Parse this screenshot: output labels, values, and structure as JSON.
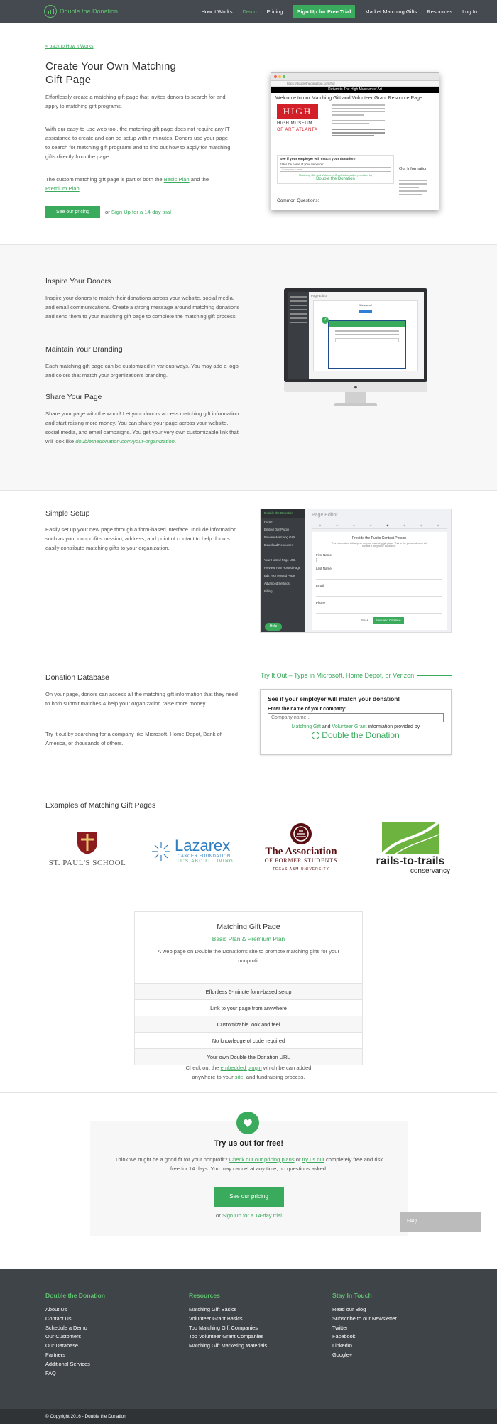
{
  "nav": {
    "logo_text": "Double the Donation",
    "items": [
      "How it Works",
      "Demo",
      "Pricing"
    ],
    "cta": "Sign Up for Free Trial",
    "items2": [
      "Market Matching Gifts",
      "Resources",
      "Log In"
    ]
  },
  "hero": {
    "back_link": "< back to How it Works",
    "title_line1": "Create Your Own Matching",
    "title_line2": "Gift Page",
    "p1": "Effortlessly create a matching gift page that invites donors to search for and apply to matching gift programs.",
    "p2": "With our easy-to-use web tool, the matching gift page does not require any IT assistance to create and can be setup within minutes. Donors use your page to search for matching gift programs and to find out how to apply for matching gifts directly from the page.",
    "p3_pre": "The custom matching gift page is part of both the ",
    "p3_link1": "Basic Plan",
    "p3_mid": " and the ",
    "p3_link2": "Premium Plan",
    "btn": "See our pricing",
    "or": "or",
    "trial": "Sign Up for a 14-day trial"
  },
  "hero_shot": {
    "url": "https://doublethedonation.com/hgl",
    "banner": "Return to The High Museum of Art",
    "welcome": "Welcome to our Matching Gift and Volunteer Grant Resource Page",
    "high": "HIGH",
    "museum1": "HIGH MUSEUM",
    "museum2": "OF ART ATLANTA",
    "search_title": "See if your employer will match your donation!",
    "search_label": "Enter the name of your company:",
    "search_ph": "Company name...",
    "search_info": "Matching Gift and Volunteer Grant information provided by",
    "common": "Common Questions:",
    "org": "Our Information"
  },
  "inspire": {
    "h": "Inspire Your Donors",
    "p": "Inspire your donors to match their donations across your website, social media, and email communications. Create a strong message around matching donations and send them to your matching gift page to complete the matching gift process."
  },
  "brand": {
    "h": "Maintain Your Branding",
    "p": "Each matching gift page can be customized in various ways. You may add a logo and colors that match your organization's branding."
  },
  "share": {
    "h": "Share Your Page",
    "p": "Share your page with the world! Let your donors access matching gift information and start raising more money. You can share your page across your website, social media, and email campaigns. You get your very own customizable link that will look like ",
    "link": "doublethedonation.com/your-organization",
    "end": "."
  },
  "mac_shot": {
    "title": "Page Editor",
    "welcome": "Welcome!"
  },
  "setup": {
    "h": "Simple Setup",
    "p": "Easily set up your new page through a form-based interface. Include information such as your nonprofit's mission, address, and point of contact to help donors easily contribute matching gifts to your organization."
  },
  "editor": {
    "brand": "Double the Donation",
    "title": "Page Editor",
    "menu": [
      "Home",
      "Embed Our Plugin",
      "Preview Matching Gifts",
      "Download Resources",
      "Your Hosted Page URL",
      "Preview Your Hosted Page",
      "Edit Your Hosted Page",
      "Advanced Settings",
      "Billing"
    ],
    "help": "Help",
    "form_title": "Provide the Public Contact Person",
    "form_sub": "This information will appear on your matching gift page. This is the person donors will contact if they have questions.",
    "fields": [
      "First Name",
      "Last Name",
      "Email",
      "Phone"
    ],
    "back": "Back",
    "save": "Save and Continue"
  },
  "db": {
    "h": "Donation Database",
    "p1": "On your page, donors can access all the matching gift information that they need to both submit matches & help your organization raise more money.",
    "p2": "Try it out by searching for a company like Microsoft, Home Depot, Bank of America, or thousands of others.",
    "try": "Try It Out – Type in Microsoft, Home Depot, or Verizon",
    "widget_title": "See if your employer will match your donation!",
    "widget_label": "Enter the name of your company:",
    "widget_ph": "Company name...",
    "widget_l1": "Matching Gift",
    "widget_and": " and ",
    "widget_l2": "Volunteer Grant",
    "widget_info": " information provided by",
    "widget_logo": "Double the Donation"
  },
  "examples": {
    "h": "Examples of Matching Gift Pages",
    "stpauls": "ST. PAUL'S SCHOOL",
    "laz1": "Lazarex",
    "laz2": "CANCER FOUNDATION",
    "laz3": "IT'S ABOUT LIVING",
    "assoc1": "The Association",
    "assoc2": "OF FORMER STUDENTS",
    "assoc3": "TEXAS A&M UNIVERSITY",
    "rails1": "rails-to-trails",
    "rails2": "conservancy"
  },
  "pkg": {
    "title": "Matching Gift Page",
    "plan": "Basic Plan & Premium Plan",
    "desc": "A web page on Double the Donation's site to promote matching gifts for your nonprofit",
    "rows": [
      "Effortless 5-minute form-based setup",
      "Link to your page from anywhere",
      "Customizable look and feel",
      "No knowledge of code required",
      "Your own Double the Donation URL"
    ]
  },
  "plugin": {
    "pre": "Check out the ",
    "link": "embedded plugin",
    "mid": " which be can added",
    "pre2": "anywhere to your ",
    "link2": "site",
    "end": ", and fundraising process."
  },
  "cta": {
    "h": "Try us out for free!",
    "p_pre": "Think we might be a good fit for your nonprofit? ",
    "l1": "Check out our pricing plans",
    "or": " or ",
    "l2": "try us out",
    "p_end": " completely free and risk free for 14 days. You may cancel at any time, no questions asked.",
    "btn": "See our pricing",
    "or2": "or",
    "trial": "Sign Up for a 14-day trial",
    "faq": "FAQ"
  },
  "footer": {
    "c1_h": "Double the Donation",
    "c1": [
      "About Us",
      "Contact Us",
      "Schedule a Demo",
      "Our Customers",
      "Our Database",
      "Partners",
      "Additional Services",
      "FAQ"
    ],
    "c2_h": "Resources",
    "c2": [
      "Matching Gift Basics",
      "Volunteer Grant Basics",
      "Top Matching Gift Companies",
      "Top Volunteer Grant Companies",
      "Matching Gift Marketing Materials"
    ],
    "c3_h": "Stay In Touch",
    "c3": [
      "Read our Blog",
      "Subscribe to our Newsletter",
      "Twitter",
      "Facebook",
      "LinkedIn",
      "Google+"
    ],
    "copy": "© Copyright 2016 - Double the Donation"
  }
}
